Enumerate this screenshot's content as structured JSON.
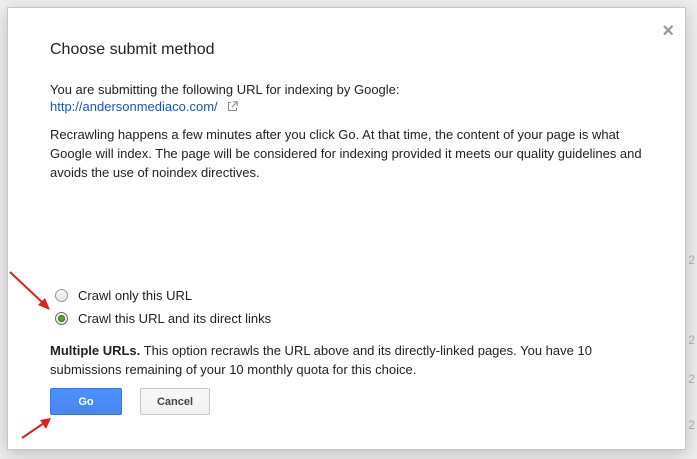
{
  "background": {
    "edge_numbers": [
      "2",
      "2",
      "2",
      "2"
    ]
  },
  "dialog": {
    "close_glyph": "×",
    "title": "Choose submit method",
    "intro_text": "You are submitting the following URL for indexing by Google:",
    "url": "http://andersonmediaco.com/",
    "description": "Recrawling happens a few minutes after you click Go. At that time, the content of your page is what Google will index. The page will be considered for indexing provided it meets our quality guidelines and avoids the use of noindex directives.",
    "options": [
      {
        "label": "Crawl only this URL",
        "checked": false
      },
      {
        "label": "Crawl this URL and its direct links",
        "checked": true
      }
    ],
    "note_bold": "Multiple URLs.",
    "note_text": " This option recrawls the URL above and its directly-linked pages. You have 10 submissions remaining of your 10 monthly quota for this choice.",
    "go_label": "Go",
    "cancel_label": "Cancel"
  },
  "colors": {
    "link": "#1155cc",
    "go_button": "#4d90fe",
    "radio_checked": "#5e9e3a",
    "annotation_arrow": "#e02020"
  }
}
